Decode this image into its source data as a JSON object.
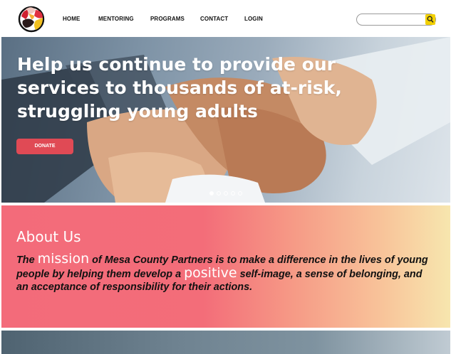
{
  "nav": {
    "items": [
      "HOME",
      "MENTORING",
      "PROGRAMS",
      "CONTACT",
      "LOGIN"
    ]
  },
  "search": {
    "value": "",
    "placeholder": "",
    "button_icon": "search-icon"
  },
  "hero": {
    "title": "Help us continue to provide our services to thousands of at-risk, struggling young adults",
    "donate_label": "DONATE",
    "carousel_count": 5,
    "carousel_active": 1
  },
  "about": {
    "heading": "About Us",
    "text_1": "The ",
    "highlight_1": "mission",
    "text_2": " of Mesa County Partners is to make a difference in the lives of young people by helping them develop a ",
    "highlight_2": "positive",
    "text_3": " self-image, a sense of belonging, and an acceptance of responsibility for their actions."
  },
  "colors": {
    "accent_donate": "#e04a55",
    "search_button": "#f2d000",
    "about_gradient_start": "#f36b7a",
    "about_gradient_end": "#f7e6ae"
  }
}
